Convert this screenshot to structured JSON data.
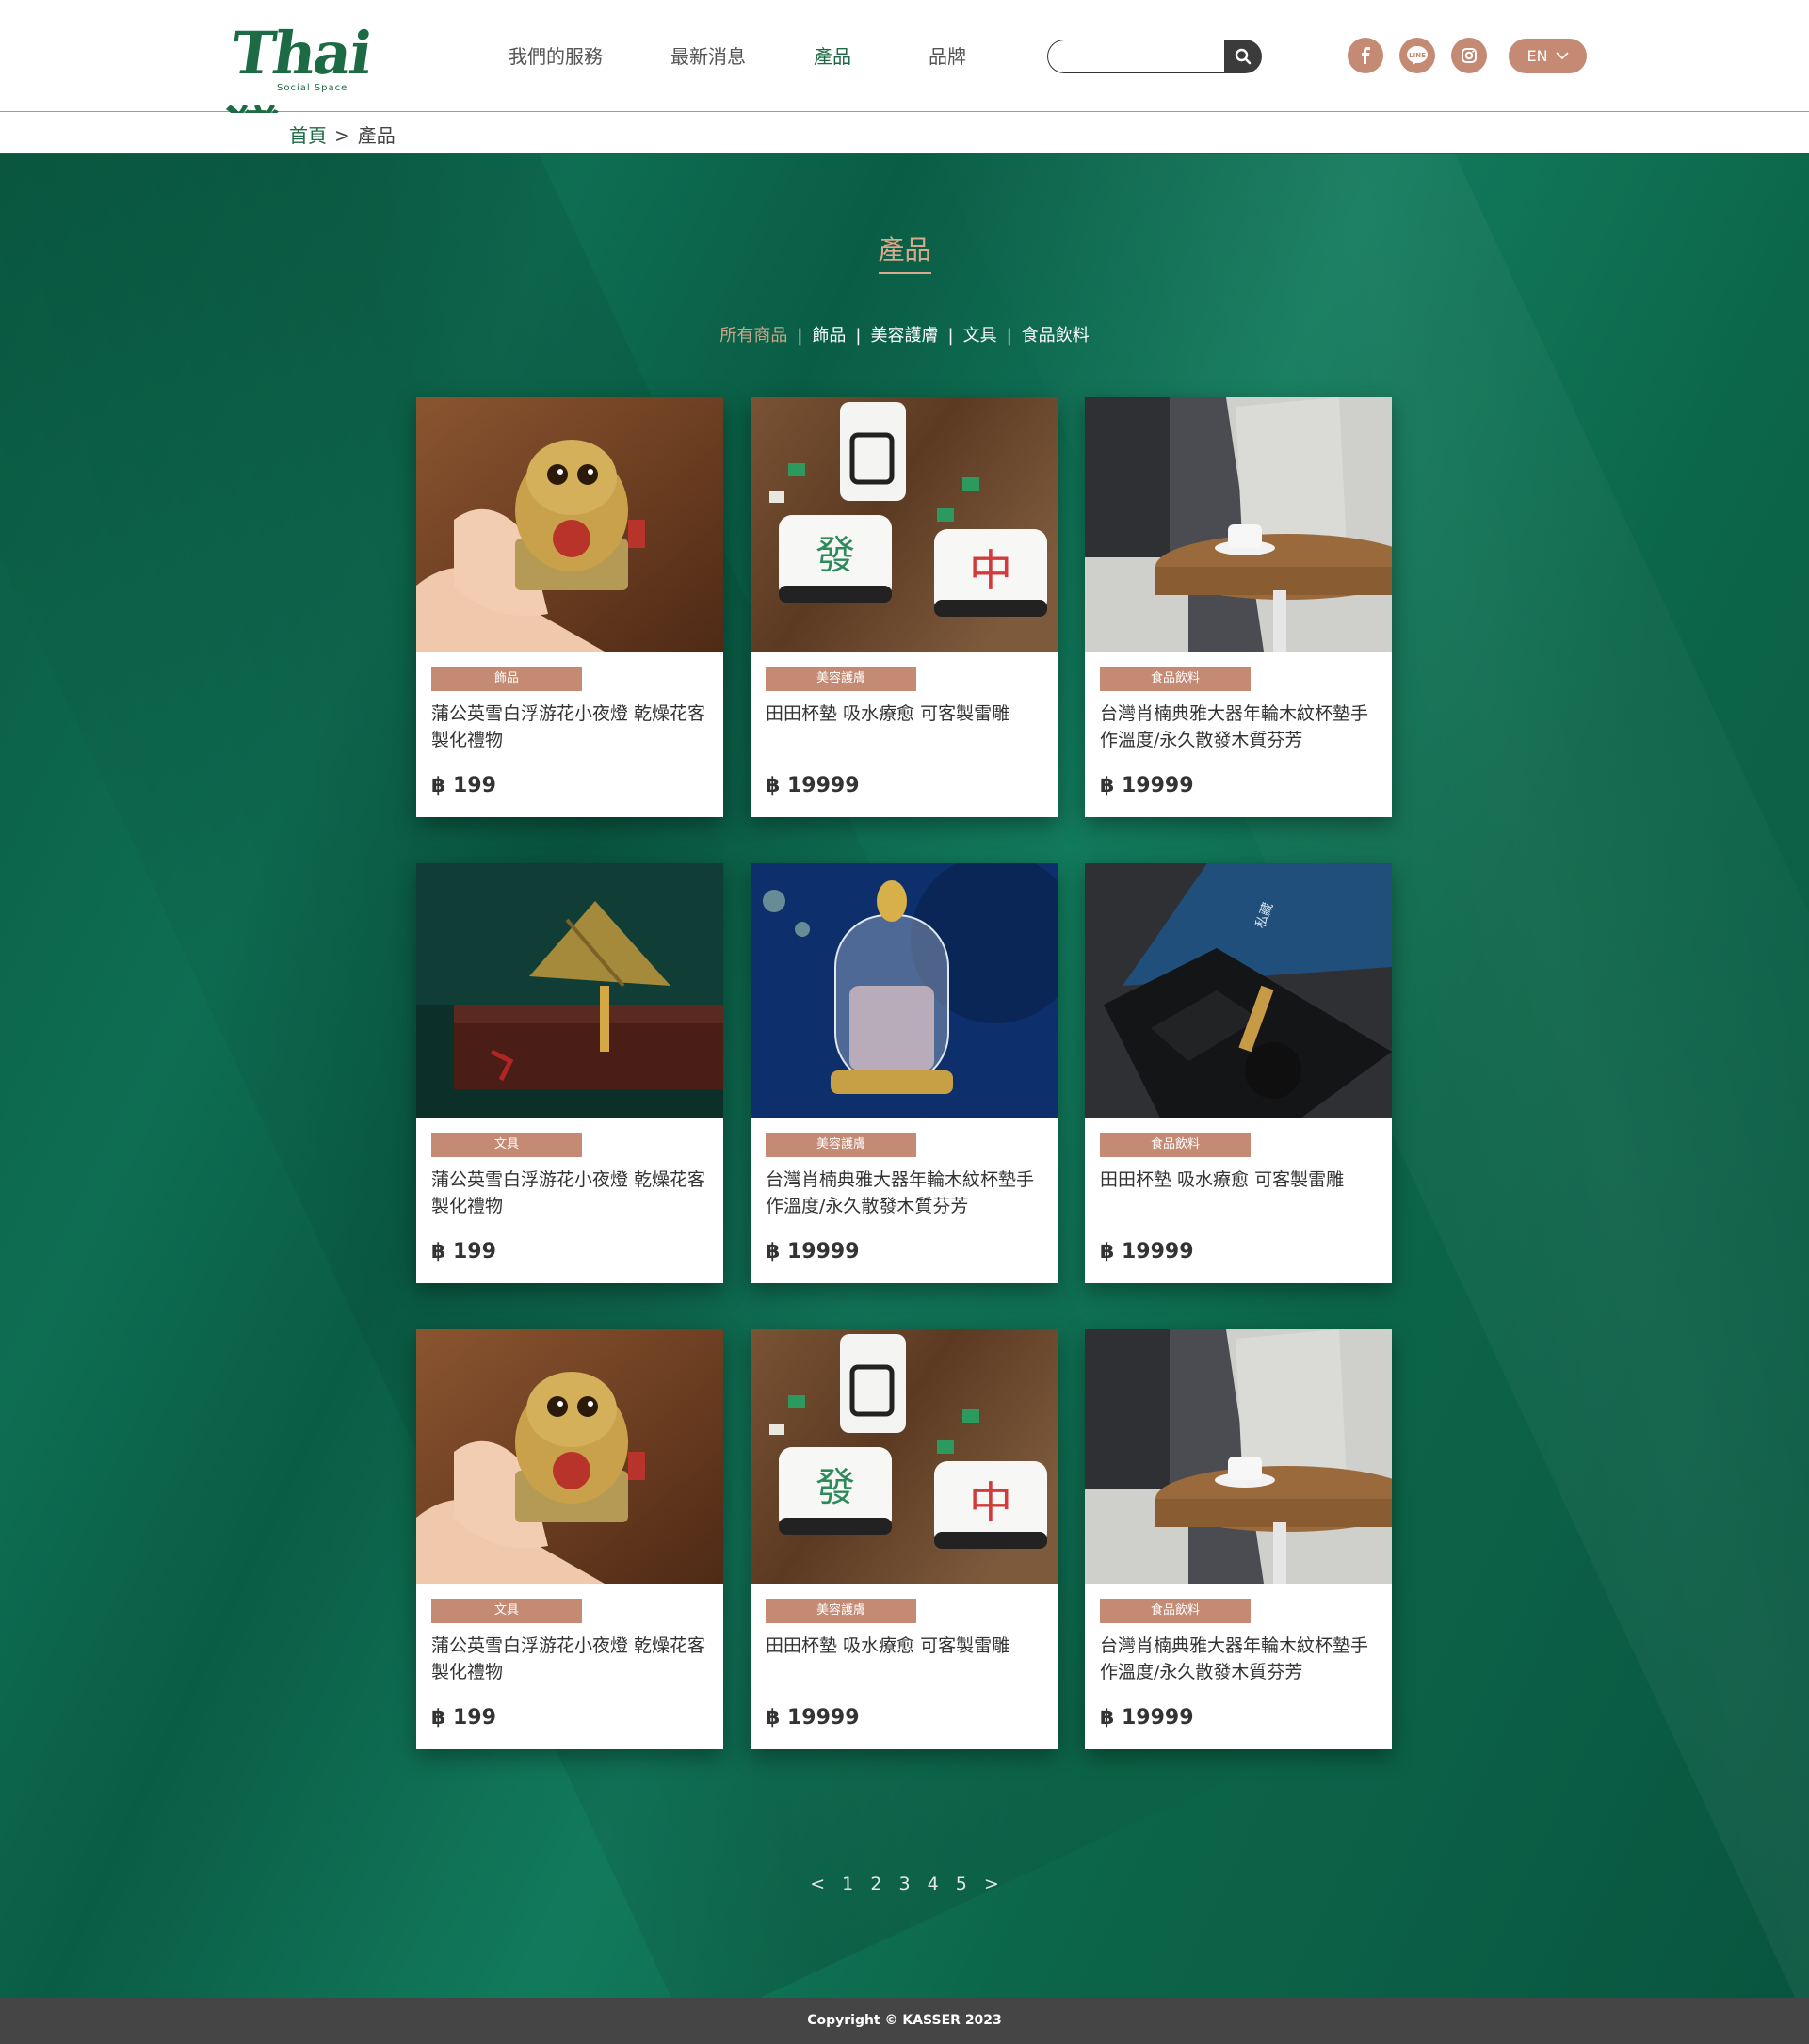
{
  "brand": {
    "logo_text": "Thai灣",
    "logo_sub": "Social Space"
  },
  "nav": {
    "items": [
      {
        "label": "我們的服務"
      },
      {
        "label": "最新消息"
      },
      {
        "label": "產品"
      },
      {
        "label": "品牌"
      }
    ],
    "active_index": 2
  },
  "search": {
    "placeholder": "",
    "value": ""
  },
  "social": {
    "items": [
      "facebook-icon",
      "line-icon",
      "instagram-icon"
    ]
  },
  "language": {
    "label": "EN"
  },
  "breadcrumb": {
    "home": "首頁",
    "separator": ">",
    "current": "產品"
  },
  "page": {
    "title": "產品"
  },
  "filters": {
    "items": [
      {
        "label": "所有商品"
      },
      {
        "label": "飾品"
      },
      {
        "label": "美容護膚"
      },
      {
        "label": "文具"
      },
      {
        "label": "食品飲料"
      }
    ],
    "separator": "|",
    "active_index": 0
  },
  "products": [
    {
      "tag": "飾品",
      "title": "蒲公英雪白浮游花小夜燈 乾燥花客製化禮物",
      "price": "฿ 199",
      "image": "cat-figurine"
    },
    {
      "tag": "美容護膚",
      "title": "田田杯墊 吸水療愈 可客製雷雕",
      "price": "฿ 19999",
      "image": "mahjong-coaster"
    },
    {
      "tag": "食品飲料",
      "title": "台灣肖楠典雅大器年輪木紋杯墊手作溫度/永久散發木質芬芳",
      "price": "฿ 19999",
      "image": "wood-table"
    },
    {
      "tag": "文具",
      "title": "蒲公英雪白浮游花小夜燈 乾燥花客製化禮物",
      "price": "฿ 199",
      "image": "rice-dumpling"
    },
    {
      "tag": "美容護膚",
      "title": "台灣肖楠典雅大器年輪木紋杯墊手作溫度/永久散發木質芬芳",
      "price": "฿ 19999",
      "image": "glass-dome"
    },
    {
      "tag": "食品飲料",
      "title": "田田杯墊 吸水療愈 可客製雷雕",
      "price": "฿ 19999",
      "image": "gift-box"
    },
    {
      "tag": "文具",
      "title": "蒲公英雪白浮游花小夜燈 乾燥花客製化禮物",
      "price": "฿ 199",
      "image": "cat-figurine"
    },
    {
      "tag": "美容護膚",
      "title": "田田杯墊 吸水療愈 可客製雷雕",
      "price": "฿ 19999",
      "image": "mahjong-coaster"
    },
    {
      "tag": "食品飲料",
      "title": "台灣肖楠典雅大器年輪木紋杯墊手作溫度/永久散發木質芬芳",
      "price": "฿ 19999",
      "image": "wood-table"
    }
  ],
  "pagination": {
    "prev": "<",
    "pages": [
      "1",
      "2",
      "3",
      "4",
      "5"
    ],
    "next": ">"
  },
  "footer": {
    "copyright": "Copyright © KASSER 2023"
  },
  "colors": {
    "brand_green": "#1d6b45",
    "accent": "#c48a74",
    "background_green": "#0e6e52",
    "footer_bg": "#454545"
  }
}
